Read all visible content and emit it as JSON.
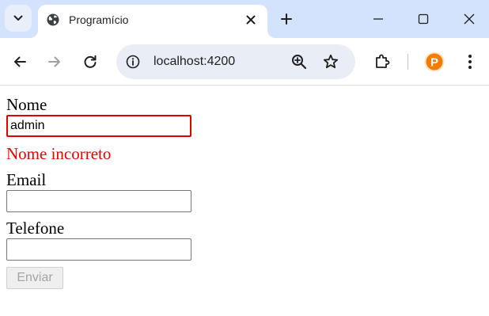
{
  "browser": {
    "tab": {
      "title": "Programício",
      "favicon": "globe-icon"
    },
    "window_controls": [
      "minimize-icon",
      "maximize-icon",
      "close-icon"
    ],
    "toolbar": {
      "url": "localhost:4200",
      "icons": [
        "back-arrow-icon",
        "forward-arrow-icon",
        "reload-icon",
        "site-info-icon",
        "zoom-icon",
        "bookmark-star-icon",
        "extensions-icon",
        "profile-avatar-icon",
        "menu-icon"
      ],
      "profile_letter": "P",
      "forward_disabled": true
    },
    "colors": {
      "tabstrip": "#d3e3fd",
      "omnibox": "#e9eef6",
      "profile_avatar": "#f57c00"
    }
  },
  "form": {
    "name_label": "Nome",
    "name_value": "admin",
    "name_error": "Nome incorreto",
    "email_label": "Email",
    "email_value": "",
    "phone_label": "Telefone",
    "phone_value": "",
    "submit_label": "Enviar",
    "submit_disabled": true,
    "colors": {
      "error": "#ee0000",
      "invalid_border": "#e00000"
    }
  }
}
